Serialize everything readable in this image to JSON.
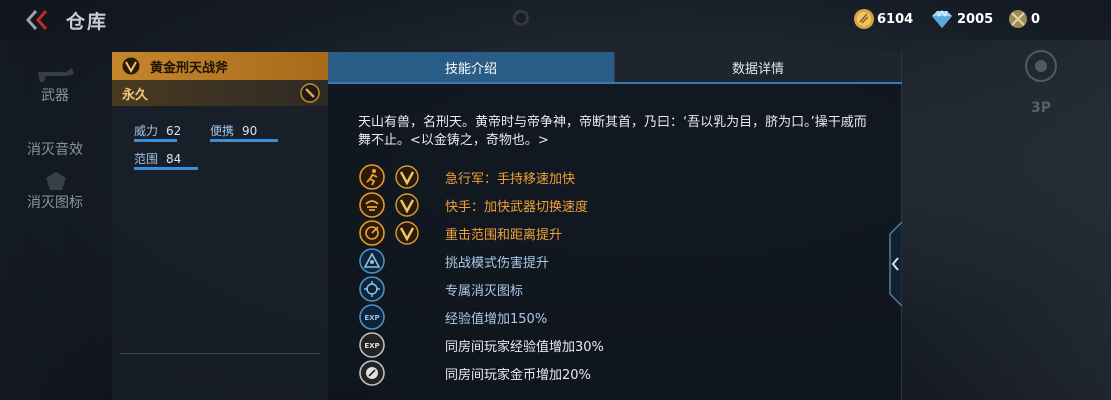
{
  "header": {
    "title": "仓库",
    "currency": [
      {
        "icon": "gold-coin-icon",
        "value": "6104"
      },
      {
        "icon": "diamond-icon",
        "value": "2005"
      },
      {
        "icon": "medal-coin-icon",
        "value": "0"
      }
    ]
  },
  "side_nav": {
    "items": [
      {
        "label": "武器"
      },
      {
        "label": "消灭音效"
      },
      {
        "label": "消灭图标"
      }
    ]
  },
  "item": {
    "name": "黄金刑天战斧",
    "duration": "永久",
    "stats": [
      {
        "label": "威力",
        "value": "62",
        "fill": 0.62
      },
      {
        "label": "便携",
        "value": "90",
        "fill": 0.9
      },
      {
        "label": "范围",
        "value": "84",
        "fill": 0.84
      }
    ]
  },
  "tabs": [
    {
      "label": "技能介绍",
      "active": true
    },
    {
      "label": "数据详情",
      "active": false
    }
  ],
  "description": "天山有兽，名刑天。黄帝时与帝争神，帝断其首，乃曰：‘吾以乳为目，脐为口。’操干戚而舞不止。<以金铸之，奇物也。>",
  "skills": [
    {
      "icon": "running-man-icon",
      "vip": true,
      "label": "急行军：手持移速加快",
      "color": "#f0a13a"
    },
    {
      "icon": "quick-hand-icon",
      "vip": true,
      "label": "快手：加快武器切换速度",
      "color": "#f0a13a"
    },
    {
      "icon": "range-target-icon",
      "vip": true,
      "label": "重击范围和距离提升",
      "color": "#f0a13a"
    },
    {
      "icon": "challenge-mode-icon",
      "vip": false,
      "label": "挑战模式伤害提升",
      "color": "#a9c9e8"
    },
    {
      "icon": "kill-icon-icon",
      "vip": false,
      "label": "专属消灭图标",
      "color": "#a9c9e8"
    },
    {
      "icon": "exp-icon",
      "vip": false,
      "label": "经验值增加150%",
      "color": "#a9c9e8"
    },
    {
      "icon": "room-exp-icon",
      "vip": false,
      "label": "同房间玩家经验值增加30%",
      "color": "#e9ecef"
    },
    {
      "icon": "room-gold-icon",
      "vip": false,
      "label": "同房间玩家金币增加20%",
      "color": "#e9ecef"
    }
  ],
  "right_side": {
    "view_label": "3P"
  }
}
